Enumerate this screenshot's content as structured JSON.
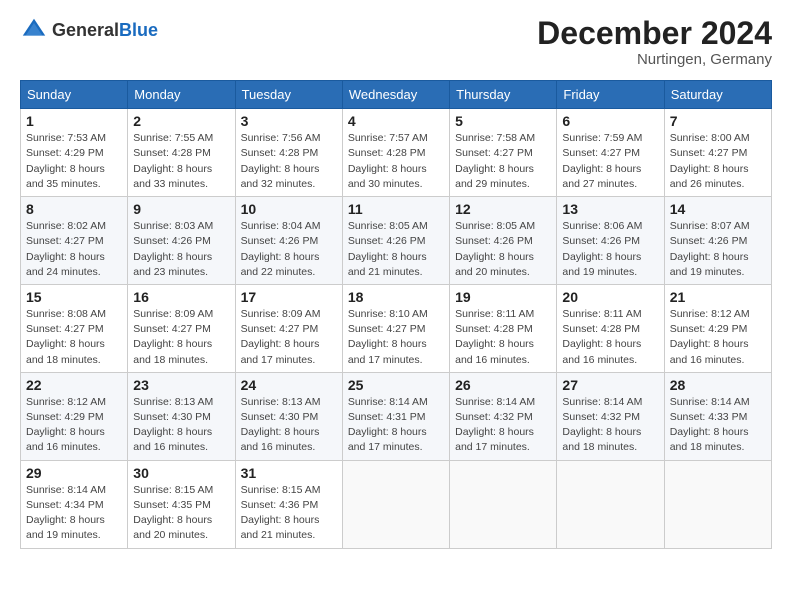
{
  "header": {
    "logo_general": "General",
    "logo_blue": "Blue",
    "month_title": "December 2024",
    "location": "Nurtingen, Germany"
  },
  "days_of_week": [
    "Sunday",
    "Monday",
    "Tuesday",
    "Wednesday",
    "Thursday",
    "Friday",
    "Saturday"
  ],
  "weeks": [
    [
      {
        "day": "1",
        "sunrise": "Sunrise: 7:53 AM",
        "sunset": "Sunset: 4:29 PM",
        "daylight": "Daylight: 8 hours and 35 minutes."
      },
      {
        "day": "2",
        "sunrise": "Sunrise: 7:55 AM",
        "sunset": "Sunset: 4:28 PM",
        "daylight": "Daylight: 8 hours and 33 minutes."
      },
      {
        "day": "3",
        "sunrise": "Sunrise: 7:56 AM",
        "sunset": "Sunset: 4:28 PM",
        "daylight": "Daylight: 8 hours and 32 minutes."
      },
      {
        "day": "4",
        "sunrise": "Sunrise: 7:57 AM",
        "sunset": "Sunset: 4:28 PM",
        "daylight": "Daylight: 8 hours and 30 minutes."
      },
      {
        "day": "5",
        "sunrise": "Sunrise: 7:58 AM",
        "sunset": "Sunset: 4:27 PM",
        "daylight": "Daylight: 8 hours and 29 minutes."
      },
      {
        "day": "6",
        "sunrise": "Sunrise: 7:59 AM",
        "sunset": "Sunset: 4:27 PM",
        "daylight": "Daylight: 8 hours and 27 minutes."
      },
      {
        "day": "7",
        "sunrise": "Sunrise: 8:00 AM",
        "sunset": "Sunset: 4:27 PM",
        "daylight": "Daylight: 8 hours and 26 minutes."
      }
    ],
    [
      {
        "day": "8",
        "sunrise": "Sunrise: 8:02 AM",
        "sunset": "Sunset: 4:27 PM",
        "daylight": "Daylight: 8 hours and 24 minutes."
      },
      {
        "day": "9",
        "sunrise": "Sunrise: 8:03 AM",
        "sunset": "Sunset: 4:26 PM",
        "daylight": "Daylight: 8 hours and 23 minutes."
      },
      {
        "day": "10",
        "sunrise": "Sunrise: 8:04 AM",
        "sunset": "Sunset: 4:26 PM",
        "daylight": "Daylight: 8 hours and 22 minutes."
      },
      {
        "day": "11",
        "sunrise": "Sunrise: 8:05 AM",
        "sunset": "Sunset: 4:26 PM",
        "daylight": "Daylight: 8 hours and 21 minutes."
      },
      {
        "day": "12",
        "sunrise": "Sunrise: 8:05 AM",
        "sunset": "Sunset: 4:26 PM",
        "daylight": "Daylight: 8 hours and 20 minutes."
      },
      {
        "day": "13",
        "sunrise": "Sunrise: 8:06 AM",
        "sunset": "Sunset: 4:26 PM",
        "daylight": "Daylight: 8 hours and 19 minutes."
      },
      {
        "day": "14",
        "sunrise": "Sunrise: 8:07 AM",
        "sunset": "Sunset: 4:26 PM",
        "daylight": "Daylight: 8 hours and 19 minutes."
      }
    ],
    [
      {
        "day": "15",
        "sunrise": "Sunrise: 8:08 AM",
        "sunset": "Sunset: 4:27 PM",
        "daylight": "Daylight: 8 hours and 18 minutes."
      },
      {
        "day": "16",
        "sunrise": "Sunrise: 8:09 AM",
        "sunset": "Sunset: 4:27 PM",
        "daylight": "Daylight: 8 hours and 18 minutes."
      },
      {
        "day": "17",
        "sunrise": "Sunrise: 8:09 AM",
        "sunset": "Sunset: 4:27 PM",
        "daylight": "Daylight: 8 hours and 17 minutes."
      },
      {
        "day": "18",
        "sunrise": "Sunrise: 8:10 AM",
        "sunset": "Sunset: 4:27 PM",
        "daylight": "Daylight: 8 hours and 17 minutes."
      },
      {
        "day": "19",
        "sunrise": "Sunrise: 8:11 AM",
        "sunset": "Sunset: 4:28 PM",
        "daylight": "Daylight: 8 hours and 16 minutes."
      },
      {
        "day": "20",
        "sunrise": "Sunrise: 8:11 AM",
        "sunset": "Sunset: 4:28 PM",
        "daylight": "Daylight: 8 hours and 16 minutes."
      },
      {
        "day": "21",
        "sunrise": "Sunrise: 8:12 AM",
        "sunset": "Sunset: 4:29 PM",
        "daylight": "Daylight: 8 hours and 16 minutes."
      }
    ],
    [
      {
        "day": "22",
        "sunrise": "Sunrise: 8:12 AM",
        "sunset": "Sunset: 4:29 PM",
        "daylight": "Daylight: 8 hours and 16 minutes."
      },
      {
        "day": "23",
        "sunrise": "Sunrise: 8:13 AM",
        "sunset": "Sunset: 4:30 PM",
        "daylight": "Daylight: 8 hours and 16 minutes."
      },
      {
        "day": "24",
        "sunrise": "Sunrise: 8:13 AM",
        "sunset": "Sunset: 4:30 PM",
        "daylight": "Daylight: 8 hours and 16 minutes."
      },
      {
        "day": "25",
        "sunrise": "Sunrise: 8:14 AM",
        "sunset": "Sunset: 4:31 PM",
        "daylight": "Daylight: 8 hours and 17 minutes."
      },
      {
        "day": "26",
        "sunrise": "Sunrise: 8:14 AM",
        "sunset": "Sunset: 4:32 PM",
        "daylight": "Daylight: 8 hours and 17 minutes."
      },
      {
        "day": "27",
        "sunrise": "Sunrise: 8:14 AM",
        "sunset": "Sunset: 4:32 PM",
        "daylight": "Daylight: 8 hours and 18 minutes."
      },
      {
        "day": "28",
        "sunrise": "Sunrise: 8:14 AM",
        "sunset": "Sunset: 4:33 PM",
        "daylight": "Daylight: 8 hours and 18 minutes."
      }
    ],
    [
      {
        "day": "29",
        "sunrise": "Sunrise: 8:14 AM",
        "sunset": "Sunset: 4:34 PM",
        "daylight": "Daylight: 8 hours and 19 minutes."
      },
      {
        "day": "30",
        "sunrise": "Sunrise: 8:15 AM",
        "sunset": "Sunset: 4:35 PM",
        "daylight": "Daylight: 8 hours and 20 minutes."
      },
      {
        "day": "31",
        "sunrise": "Sunrise: 8:15 AM",
        "sunset": "Sunset: 4:36 PM",
        "daylight": "Daylight: 8 hours and 21 minutes."
      },
      null,
      null,
      null,
      null
    ]
  ]
}
